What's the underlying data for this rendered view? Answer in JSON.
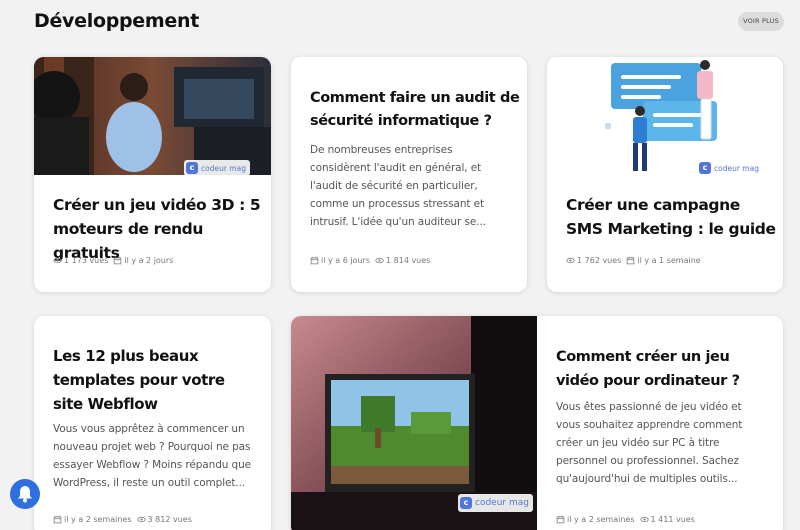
{
  "section": {
    "title": "Développement",
    "see_more_label": "VOIR PLUS"
  },
  "brand": {
    "name": "codeur mag",
    "logo_letter": "c"
  },
  "cards": [
    {
      "title": "Créer un jeu vidéo 3D : 5 moteurs de rendu gratuits",
      "excerpt": "",
      "views": "1 173 vues",
      "date": "il y a 2 jours"
    },
    {
      "title": "Comment faire un audit de sécurité informatique ?",
      "excerpt": "De nombreuses entreprises considèrent l'audit en général, et l'audit de sécurité en particulier, comme un processus stressant et intrusif. L'idée qu'un auditeur se...",
      "views": "1 814 vues",
      "date": "il y a 6 jours"
    },
    {
      "title": "Créer une campagne SMS Marketing : le guide",
      "excerpt": "",
      "views": "1 762 vues",
      "date": "il y a 1 semaine"
    },
    {
      "title": "Les 12 plus beaux templates pour votre site Webflow",
      "excerpt": "Vous vous apprêtez à commencer un nouveau projet web ? Pourquoi ne pas essayer Webflow ? Moins répandu que WordPress, il reste un outil complet...",
      "views": "3 812 vues",
      "date": "il y a 2 semaines"
    },
    {
      "title": "Comment créer un jeu vidéo pour ordinateur ?",
      "excerpt": "Vous êtes passionné de jeu vidéo et vous souhaitez apprendre comment créer un jeu vidéo sur PC à titre personnel ou professionnel. Sachez qu'aujourd'hui de multiples outils...",
      "views": "1 411 vues",
      "date": "il y a 2 semaines"
    }
  ],
  "colors": {
    "background": "#f2f2f2",
    "accent": "#2f6fe0",
    "brand": "#5276d8"
  },
  "icons": [
    "eye-icon",
    "calendar-icon",
    "bell-icon",
    "codeur-mag-logo"
  ]
}
